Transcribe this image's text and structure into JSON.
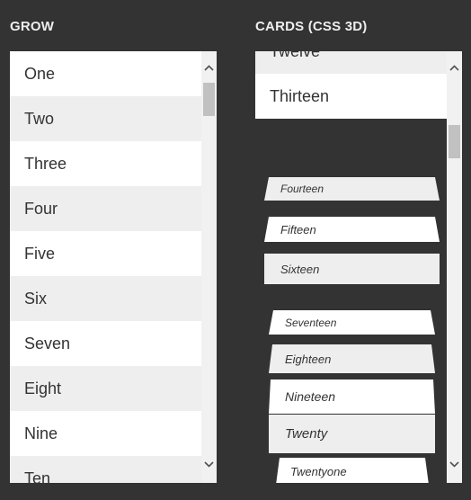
{
  "headings": {
    "grow": "GROW",
    "cards": "CARDS (CSS 3D)"
  },
  "grow": {
    "items": [
      "One",
      "Two",
      "Three",
      "Four",
      "Five",
      "Six",
      "Seven",
      "Eight",
      "Nine",
      "Ten"
    ]
  },
  "cards": {
    "flat_items": [
      "Twelve",
      "Thirteen"
    ],
    "items": [
      "Fourteen",
      "Fifteen",
      "Sixteen",
      "Seventeen",
      "Eighteen",
      "Nineteen",
      "Twenty",
      "Twentyone"
    ]
  },
  "colors": {
    "background": "#333333",
    "item_alt": "#eeeeee",
    "item_plain": "#ffffff",
    "text": "#333333",
    "heading": "#eeeeee",
    "scrollbar_track": "#f1f1f1",
    "scrollbar_thumb": "#c1c1c1"
  },
  "icons": {
    "scroll_up": "chevron-up-icon",
    "scroll_down": "chevron-down-icon"
  }
}
